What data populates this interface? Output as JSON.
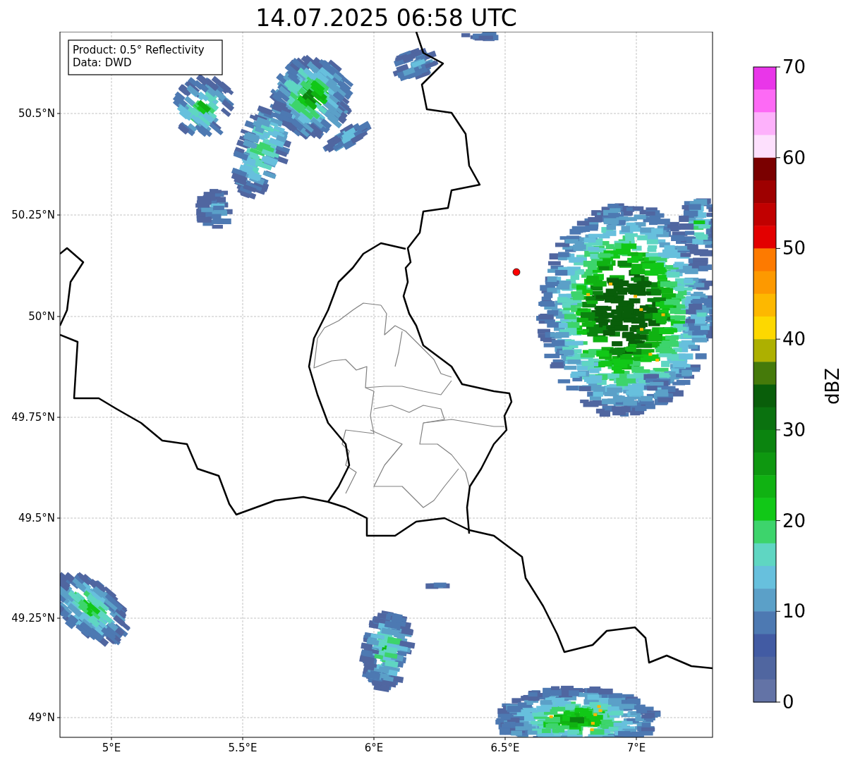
{
  "title": "14.07.2025 06:58 UTC",
  "info_box": [
    "Product: 0.5° Reflectivity",
    "Data: DWD"
  ],
  "map": {
    "x_ticks": [
      "5°E",
      "5.5°E",
      "6°E",
      "6.5°E",
      "7°E"
    ],
    "y_ticks": [
      "50.5°N",
      "50.25°N",
      "50°N",
      "49.75°N",
      "49.5°N",
      "49.25°N",
      "49°N"
    ]
  },
  "colorbar": {
    "label": "dBZ",
    "ticks": [
      "70",
      "60",
      "50",
      "40",
      "30",
      "20",
      "10",
      "0"
    ],
    "bins": [
      {
        "color": "#e936e9"
      },
      {
        "color": "#fd6af5"
      },
      {
        "color": "#fdb1fb"
      },
      {
        "color": "#fde0fd"
      },
      {
        "color": "#7a0000"
      },
      {
        "color": "#9e0000"
      },
      {
        "color": "#c10000"
      },
      {
        "color": "#e30000"
      },
      {
        "color": "#fd7a00"
      },
      {
        "color": "#fd9900"
      },
      {
        "color": "#fdb800"
      },
      {
        "color": "#fdd800"
      },
      {
        "color": "#adb000"
      },
      {
        "color": "#457a0a"
      },
      {
        "color": "#095e0a"
      },
      {
        "color": "#0a720f"
      },
      {
        "color": "#0b840f"
      },
      {
        "color": "#0e9810"
      },
      {
        "color": "#10b212"
      },
      {
        "color": "#11c817"
      },
      {
        "color": "#3dd46c"
      },
      {
        "color": "#5fd6c2"
      },
      {
        "color": "#67c0dd"
      },
      {
        "color": "#5ba0c8"
      },
      {
        "color": "#4d79b2"
      },
      {
        "color": "#425ba3"
      },
      {
        "color": "#5066a0"
      },
      {
        "color": "#6373a6"
      }
    ]
  }
}
